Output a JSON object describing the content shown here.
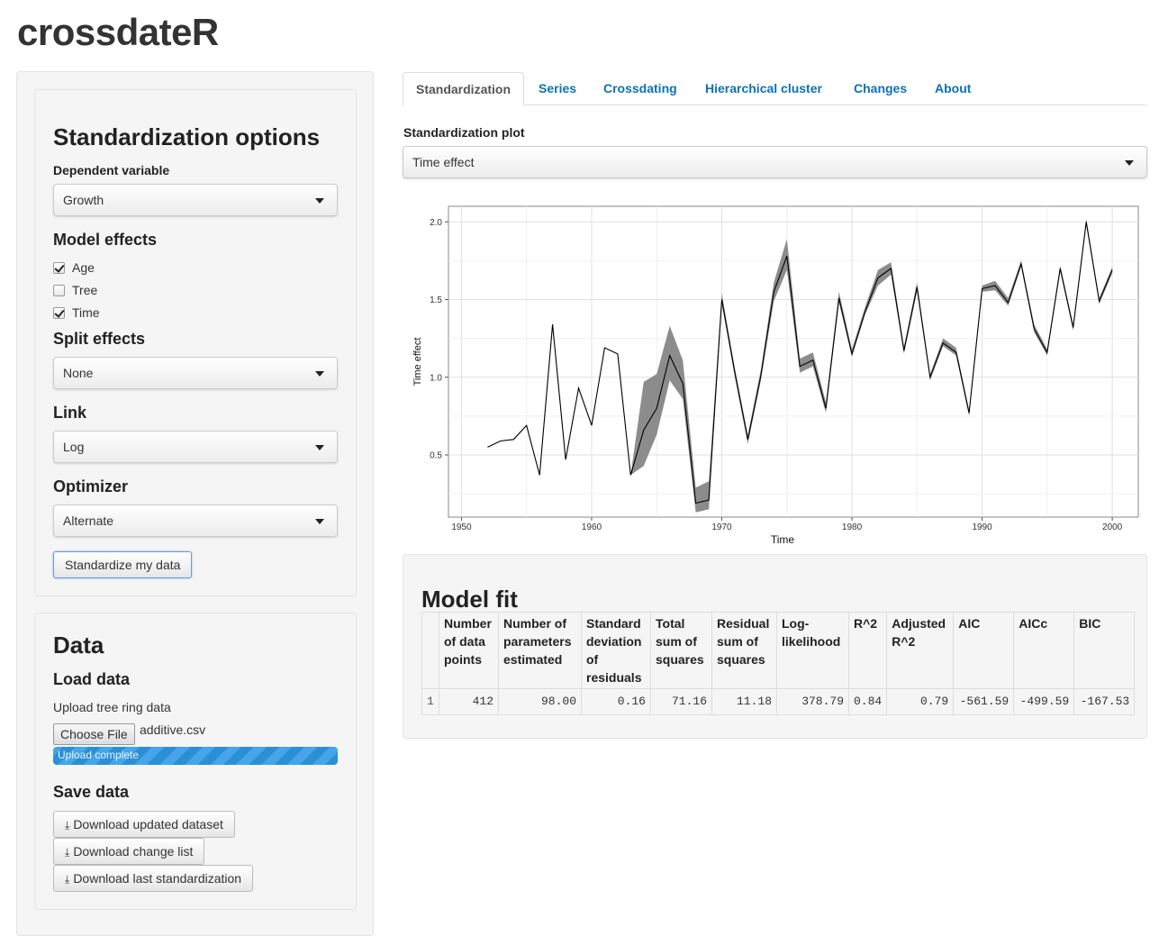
{
  "app": {
    "title": "crossdateR"
  },
  "sidebar": {
    "standardization": {
      "heading": "Standardization options",
      "dependent_variable": {
        "label": "Dependent variable",
        "value": "Growth"
      },
      "model_effects": {
        "heading": "Model effects",
        "options": [
          {
            "label": "Age",
            "checked": true
          },
          {
            "label": "Tree",
            "checked": false
          },
          {
            "label": "Time",
            "checked": true
          }
        ]
      },
      "split_effects": {
        "heading": "Split effects",
        "value": "None"
      },
      "link": {
        "heading": "Link",
        "value": "Log"
      },
      "optimizer": {
        "heading": "Optimizer",
        "value": "Alternate"
      },
      "standardize_button": "Standardize my data"
    },
    "data": {
      "heading": "Data",
      "load_heading": "Load data",
      "upload_label": "Upload tree ring data",
      "choose_file_button": "Choose File",
      "file_name": "additive.csv",
      "upload_status": "Upload complete",
      "upload_progress": 1.0,
      "save_heading": "Save data",
      "download_buttons": [
        "Download updated dataset",
        "Download change list",
        "Download last standardization"
      ]
    }
  },
  "tabs": [
    {
      "label": "Standardization",
      "active": true
    },
    {
      "label": "Series",
      "active": false
    },
    {
      "label": "Crossdating",
      "active": false
    },
    {
      "label": "Hierarchical cluster",
      "active": false
    },
    {
      "label": "Changes",
      "active": false
    },
    {
      "label": "About",
      "active": false
    }
  ],
  "main": {
    "plot_label": "Standardization plot",
    "plot_select": "Time effect"
  },
  "chart_data": {
    "type": "line",
    "title": "",
    "xlabel": "Time",
    "ylabel": "Time effect",
    "xlim": [
      1949,
      2002
    ],
    "ylim": [
      0.1,
      2.1
    ],
    "xticks": [
      1950,
      1960,
      1970,
      1980,
      1990,
      2000
    ],
    "yticks": [
      0.5,
      1.0,
      1.5,
      2.0
    ],
    "grid": true,
    "series": [
      {
        "x": [
          1952,
          1953,
          1954,
          1955,
          1956,
          1957,
          1958,
          1959,
          1960,
          1961,
          1962,
          1963,
          1964,
          1965,
          1966,
          1967,
          1968,
          1969,
          1970,
          1971,
          1972,
          1973,
          1974,
          1975,
          1976,
          1977,
          1978,
          1979,
          1980,
          1981,
          1982,
          1983,
          1984,
          1985,
          1986,
          1987,
          1988,
          1989,
          1990,
          1991,
          1992,
          1993,
          1994,
          1995,
          1996,
          1997,
          1998,
          1999,
          2000
        ],
        "y": [
          0.55,
          0.59,
          0.6,
          0.69,
          0.37,
          1.34,
          0.47,
          0.93,
          0.69,
          1.19,
          1.15,
          0.37,
          0.66,
          0.8,
          1.14,
          0.96,
          0.19,
          0.21,
          1.5,
          1.03,
          0.6,
          1.01,
          1.55,
          1.78,
          1.07,
          1.11,
          0.8,
          1.51,
          1.15,
          1.42,
          1.64,
          1.7,
          1.17,
          1.58,
          1.0,
          1.22,
          1.16,
          0.77,
          1.57,
          1.59,
          1.48,
          1.73,
          1.31,
          1.16,
          1.7,
          1.32,
          2.0,
          1.49,
          1.69
        ],
        "lower": [
          0.55,
          0.59,
          0.6,
          0.69,
          0.37,
          1.34,
          0.47,
          0.93,
          0.69,
          1.19,
          1.15,
          0.37,
          0.43,
          0.63,
          0.98,
          0.86,
          0.13,
          0.15,
          1.47,
          1.0,
          0.57,
          0.98,
          1.49,
          1.69,
          1.03,
          1.07,
          0.77,
          1.48,
          1.13,
          1.4,
          1.59,
          1.66,
          1.15,
          1.55,
          0.98,
          1.2,
          1.14,
          0.75,
          1.55,
          1.56,
          1.46,
          1.71,
          1.29,
          1.14,
          1.68,
          1.3,
          1.98,
          1.47,
          1.67
        ],
        "upper": [
          0.55,
          0.59,
          0.6,
          0.69,
          0.37,
          1.34,
          0.47,
          0.93,
          0.69,
          1.19,
          1.15,
          0.37,
          0.97,
          1.02,
          1.33,
          1.11,
          0.29,
          0.33,
          1.54,
          1.06,
          0.63,
          1.05,
          1.61,
          1.89,
          1.12,
          1.16,
          0.84,
          1.55,
          1.18,
          1.45,
          1.69,
          1.74,
          1.2,
          1.61,
          1.02,
          1.25,
          1.19,
          0.79,
          1.59,
          1.62,
          1.51,
          1.75,
          1.34,
          1.18,
          1.72,
          1.34,
          2.02,
          1.51,
          1.71
        ]
      }
    ]
  },
  "model_fit": {
    "heading": "Model fit",
    "columns": [
      "Number of data points",
      "Number of parameters estimated",
      "Standard deviation of residuals",
      "Total sum of squares",
      "Residual sum of squares",
      "Log-likelihood",
      "R^2",
      "Adjusted R^2",
      "AIC",
      "AICc",
      "BIC"
    ],
    "rows": [
      {
        "id": "1",
        "values": [
          "412",
          "98.00",
          "0.16",
          "71.16",
          "11.18",
          "378.79",
          "0.84",
          "0.79",
          "-561.59",
          "-499.59",
          "-167.53"
        ]
      }
    ]
  }
}
